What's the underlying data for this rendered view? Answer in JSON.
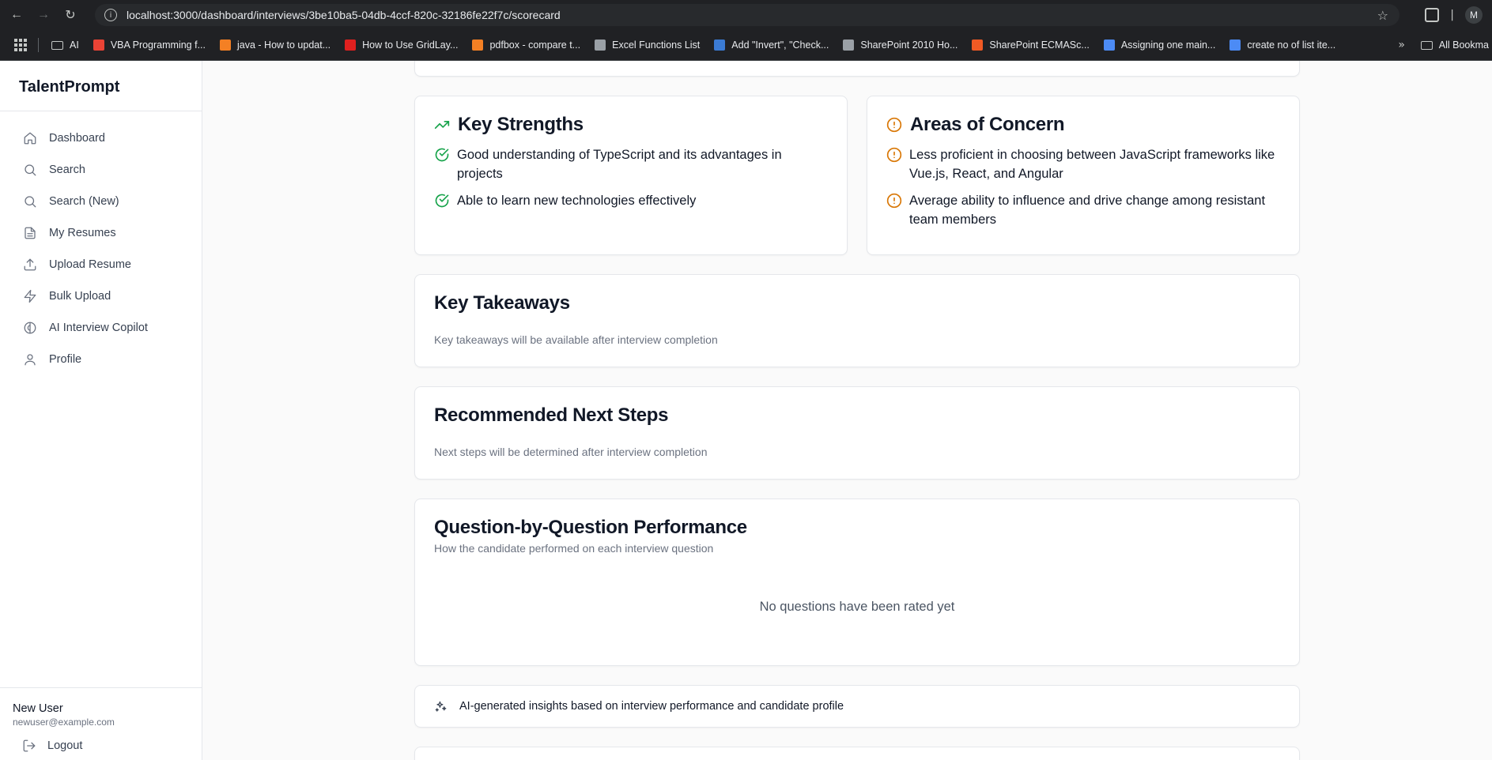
{
  "browser": {
    "url": "localhost:3000/dashboard/interviews/3be10ba5-04db-4ccf-820c-32186fe22f7c/scorecard",
    "profile_initial": "M",
    "bookmarks": [
      {
        "label": "AI",
        "type": "folder"
      },
      {
        "label": "VBA Programming f...",
        "color": "#ea4335"
      },
      {
        "label": "java - How to updat...",
        "color": "#f48024"
      },
      {
        "label": "How to Use GridLay...",
        "color": "#e0201f"
      },
      {
        "label": "pdfbox - compare t...",
        "color": "#f48024"
      },
      {
        "label": "Excel Functions List",
        "color": "#9aa0a6"
      },
      {
        "label": "Add \"Invert\", \"Check...",
        "color": "#3b7bd4"
      },
      {
        "label": "SharePoint 2010 Ho...",
        "color": "#9aa0a6"
      },
      {
        "label": "SharePoint ECMASc...",
        "color": "#f15a24"
      },
      {
        "label": "Assigning one main...",
        "color": "#4c8bf5"
      },
      {
        "label": "create no of list ite...",
        "color": "#4c8bf5"
      }
    ],
    "all_bookmarks": "All Bookma"
  },
  "sidebar": {
    "brand": "TalentPrompt",
    "items": [
      {
        "label": "Dashboard",
        "icon": "home-icon"
      },
      {
        "label": "Search",
        "icon": "search-icon"
      },
      {
        "label": "Search (New)",
        "icon": "search-icon"
      },
      {
        "label": "My Resumes",
        "icon": "document-icon"
      },
      {
        "label": "Upload Resume",
        "icon": "upload-icon"
      },
      {
        "label": "Bulk Upload",
        "icon": "bolt-icon"
      },
      {
        "label": "AI Interview Copilot",
        "icon": "brain-icon"
      },
      {
        "label": "Profile",
        "icon": "user-icon"
      }
    ],
    "user": {
      "name": "New User",
      "email": "newuser@example.com"
    },
    "logout": "Logout"
  },
  "strengths": {
    "title": "Key Strengths",
    "items": [
      "Good understanding of TypeScript and its advantages in projects",
      "Able to learn new technologies effectively"
    ]
  },
  "concerns": {
    "title": "Areas of Concern",
    "items": [
      "Less proficient in choosing between JavaScript frameworks like Vue.js, React, and Angular",
      "Average ability to influence and drive change among resistant team members"
    ]
  },
  "takeaways": {
    "title": "Key Takeaways",
    "text": "Key takeaways will be available after interview completion"
  },
  "next_steps": {
    "title": "Recommended Next Steps",
    "text": "Next steps will be determined after interview completion"
  },
  "questions": {
    "title": "Question-by-Question Performance",
    "subtitle": "How the candidate performed on each interview question",
    "empty": "No questions have been rated yet"
  },
  "ai_note": "AI-generated insights based on interview performance and candidate profile",
  "colors": {
    "success": "#16a34a",
    "warning": "#d97706"
  }
}
